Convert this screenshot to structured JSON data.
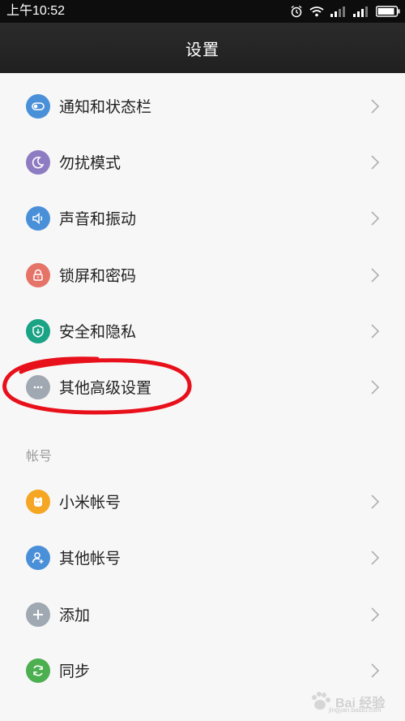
{
  "status_bar": {
    "time": "上午10:52"
  },
  "header": {
    "title": "设置"
  },
  "items": [
    {
      "label": "通知和状态栏",
      "color": "#4a90d9",
      "icon": "toggle-icon"
    },
    {
      "label": "勿扰模式",
      "color": "#8e7cc3",
      "icon": "moon-icon"
    },
    {
      "label": "声音和振动",
      "color": "#4a90d9",
      "icon": "speaker-icon"
    },
    {
      "label": "锁屏和密码",
      "color": "#e57368",
      "icon": "lock-icon"
    },
    {
      "label": "安全和隐私",
      "color": "#1aa385",
      "icon": "shield-icon"
    },
    {
      "label": "其他高级设置",
      "color": "#a0a8b2",
      "icon": "more-icon"
    }
  ],
  "section_accounts": {
    "title": "帐号",
    "items": [
      {
        "label": "小米帐号",
        "color": "#f5a623",
        "icon": "mi-face-icon"
      },
      {
        "label": "其他帐号",
        "color": "#4a90d9",
        "icon": "person-add-icon"
      },
      {
        "label": "添加",
        "color": "#a0a8b2",
        "icon": "plus-icon"
      },
      {
        "label": "同步",
        "color": "#4caf50",
        "icon": "sync-icon"
      }
    ]
  },
  "annotation_color": "#e8101a",
  "watermark": {
    "brand": "Bai 经验",
    "url": "jingyan.baidu.com"
  }
}
